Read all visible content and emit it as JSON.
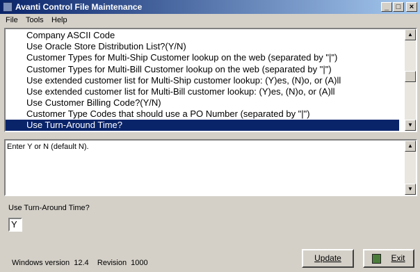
{
  "window": {
    "title": "Avanti Control File Maintenance"
  },
  "menu": [
    "File",
    "Tools",
    "Help"
  ],
  "list": {
    "items": [
      "Company ASCII Code",
      "Use Oracle Store Distribution List?(Y/N)",
      "Customer Types for Multi-Ship Customer lookup on the web (separated by \"|\")",
      "Customer Types for Multi-Bill Customer lookup on the web (separated by \"|\")",
      "Use extended customer list for Multi-Ship customer lookup: (Y)es, (N)o, or (A)ll",
      "Use extended customer list for Multi-Bill customer lookup: (Y)es, (N)o, or (A)ll",
      "Use Customer Billing Code?(Y/N)",
      "Customer Type Codes that should use a PO Number (separated by \"|\")",
      "Use Turn-Around Time?"
    ],
    "selected_index": 8
  },
  "help_text": "Enter Y or N (default N).",
  "field": {
    "label": "Use Turn-Around Time?",
    "value": "Y"
  },
  "status": {
    "version": "Windows version  12.4    Revision  1000"
  },
  "buttons": {
    "update": "Update",
    "exit": "Exit"
  },
  "colors": {
    "selection": "#0a246a",
    "titlebar": "#0a246a",
    "window_bg": "#d4d0c8"
  }
}
